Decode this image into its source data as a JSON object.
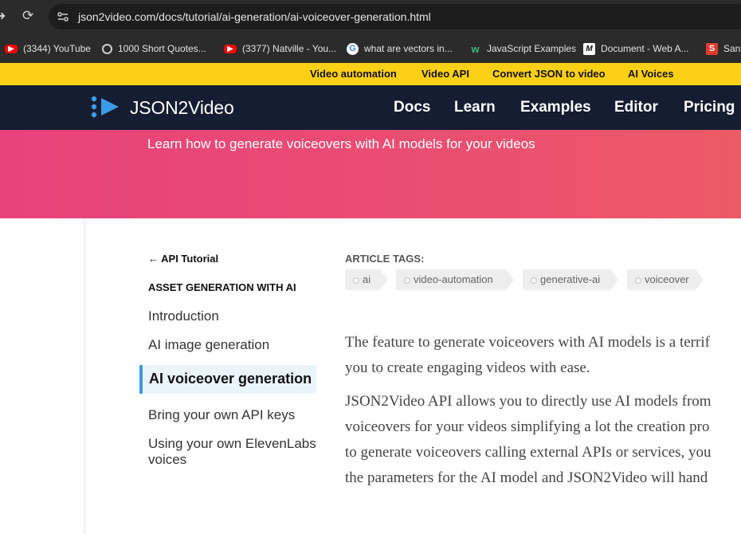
{
  "browser": {
    "url": "json2video.com/docs/tutorial/ai-generation/ai-voiceover-generation.html",
    "bookmarks": [
      {
        "label": "(3344) YouTube",
        "icon": "youtube-icon"
      },
      {
        "label": "1000 Short Quotes...",
        "icon": "globe-icon"
      },
      {
        "label": "(3377) Natville - You...",
        "icon": "youtube-icon"
      },
      {
        "label": "what are vectors in...",
        "icon": "google-icon"
      },
      {
        "label": "JavaScript Examples",
        "icon": "w3schools-icon"
      },
      {
        "label": "Document - Web A...",
        "icon": "mdn-icon"
      },
      {
        "label": "Sani",
        "icon": "s-icon"
      }
    ]
  },
  "promo_bar": {
    "links": [
      "Video automation",
      "Video API",
      "Convert JSON to video",
      "AI Voices"
    ]
  },
  "header": {
    "brand": "JSON2Video",
    "nav": [
      "Docs",
      "Learn",
      "Examples",
      "Editor",
      "Pricing"
    ]
  },
  "hero": {
    "subtitle": "Learn how to generate voiceovers with AI models for your videos"
  },
  "sidebar": {
    "back_link": "← API Tutorial",
    "section_title": "ASSET GENERATION WITH AI",
    "items": [
      {
        "label": "Introduction"
      },
      {
        "label": "AI image generation"
      },
      {
        "label": "AI voiceover generation",
        "active": true
      },
      {
        "label": "Bring your own API keys"
      },
      {
        "label": "Using your own ElevenLabs voices"
      }
    ]
  },
  "article": {
    "tags_label": "ARTICLE TAGS:",
    "tags": [
      "ai",
      "video-automation",
      "generative-ai",
      "voiceover"
    ],
    "lines": [
      "The feature to generate voiceovers with AI models is a terrif",
      "you to create engaging videos with ease.",
      "JSON2Video API allows you to directly use AI models from",
      "voiceovers for your videos simplifying a lot the creation pro",
      "to generate voiceovers calling external APIs or services, you",
      "the parameters for the AI model and JSON2Video will hand"
    ]
  },
  "colors": {
    "promo_bg": "#fcd015",
    "header_bg": "#141d32",
    "hero_gradient_start": "#e8427b",
    "hero_gradient_end": "#ec5a66",
    "active_accent": "#3a9ad9",
    "logo_blue": "#3b9be6"
  }
}
